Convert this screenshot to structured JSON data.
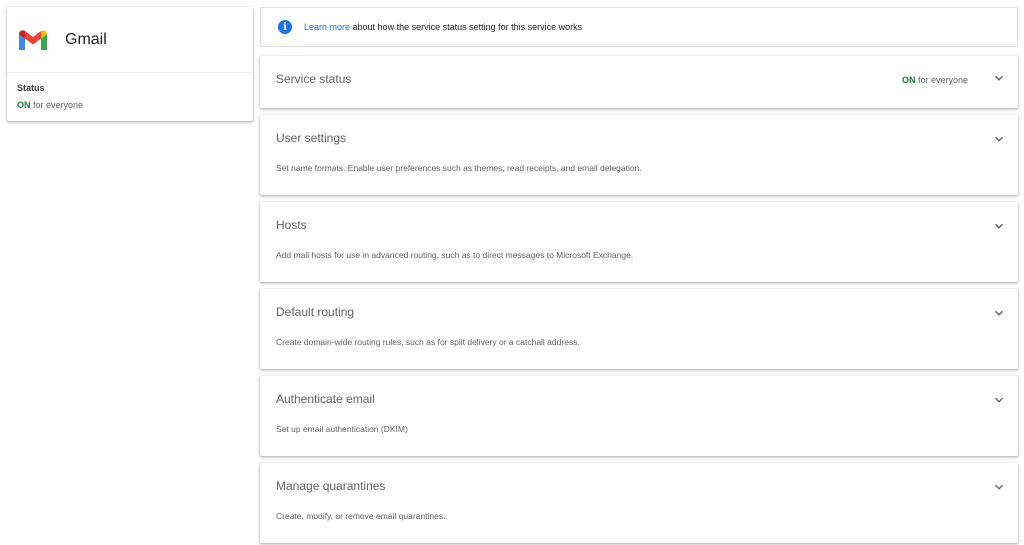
{
  "app": {
    "name": "Gmail",
    "status_label": "Status",
    "status_on": "ON",
    "status_scope": " for everyone"
  },
  "info": {
    "link_text": "Learn more",
    "text": " about how the service status setting for this service works"
  },
  "service_status": {
    "title": "Service status",
    "value_on": "ON",
    "value_scope": " for everyone"
  },
  "sections": [
    {
      "title": "User settings",
      "description": "Set name formats. Enable user preferences such as themes, read receipts, and email delegation."
    },
    {
      "title": "Hosts",
      "description": "Add mail hosts for use in advanced routing, such as to direct messages to Microsoft Exchange."
    },
    {
      "title": "Default routing",
      "description": "Create domain-wide routing rules, such as for split delivery or a catchall address."
    },
    {
      "title": "Authenticate email",
      "description": "Set up email authentication (DKIM)"
    },
    {
      "title": "Manage quarantines",
      "description": "Create, modify, or remove email quarantines."
    }
  ],
  "icons": {
    "logo": "gmail-logo-icon",
    "info": "info-icon",
    "expand": "chevron-down-icon"
  },
  "colors": {
    "on_green": "#188038",
    "link_blue": "#1a73e8",
    "text_gray": "#5f6368"
  }
}
